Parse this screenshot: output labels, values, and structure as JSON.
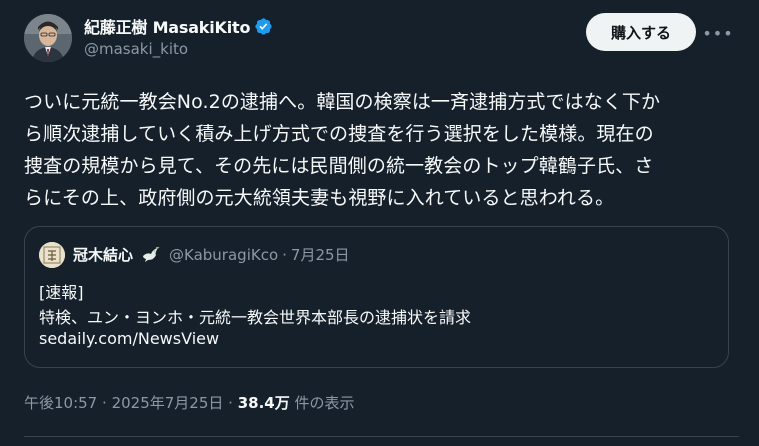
{
  "author": {
    "display_name": "紀藤正樹 MasakiKito",
    "handle": "@masaki_kito",
    "verified": true
  },
  "actions": {
    "buy_label": "購入する",
    "more_label": "•••"
  },
  "tweet": {
    "lines": [
      "ついに元統一教会No.2の逮捕へ。韓国の検察は一斉逮捕方式ではなく下か",
      "ら順次逮捕していく積み上げ方式での捜査を行う選択をした模様。現在の",
      "捜査の規模から見て、その先には民間側の統一教会のトップ韓鶴子氏、さ",
      "らにその上、政府側の元大統領夫妻も視野に入れていると思われる。"
    ]
  },
  "quoted": {
    "display_name": "冠木結心",
    "handle": "@KaburagiKco",
    "separator": "·",
    "date": "7月25日",
    "lines": [
      "[速報]",
      "特検、ユン・ヨンホ・元統一教会世界本部長の逮捕状を請求",
      "sedaily.com/NewsView"
    ]
  },
  "meta": {
    "time": "午後10:57",
    "separator": "·",
    "date": "2025年7月25日",
    "views_count": "38.4万",
    "views_label": " 件の表示"
  },
  "colors": {
    "background": "#15202b",
    "text_primary": "#f7f9f9",
    "text_secondary": "#8b98a5",
    "verified_blue": "#1d9bf0",
    "border": "#38444d"
  }
}
